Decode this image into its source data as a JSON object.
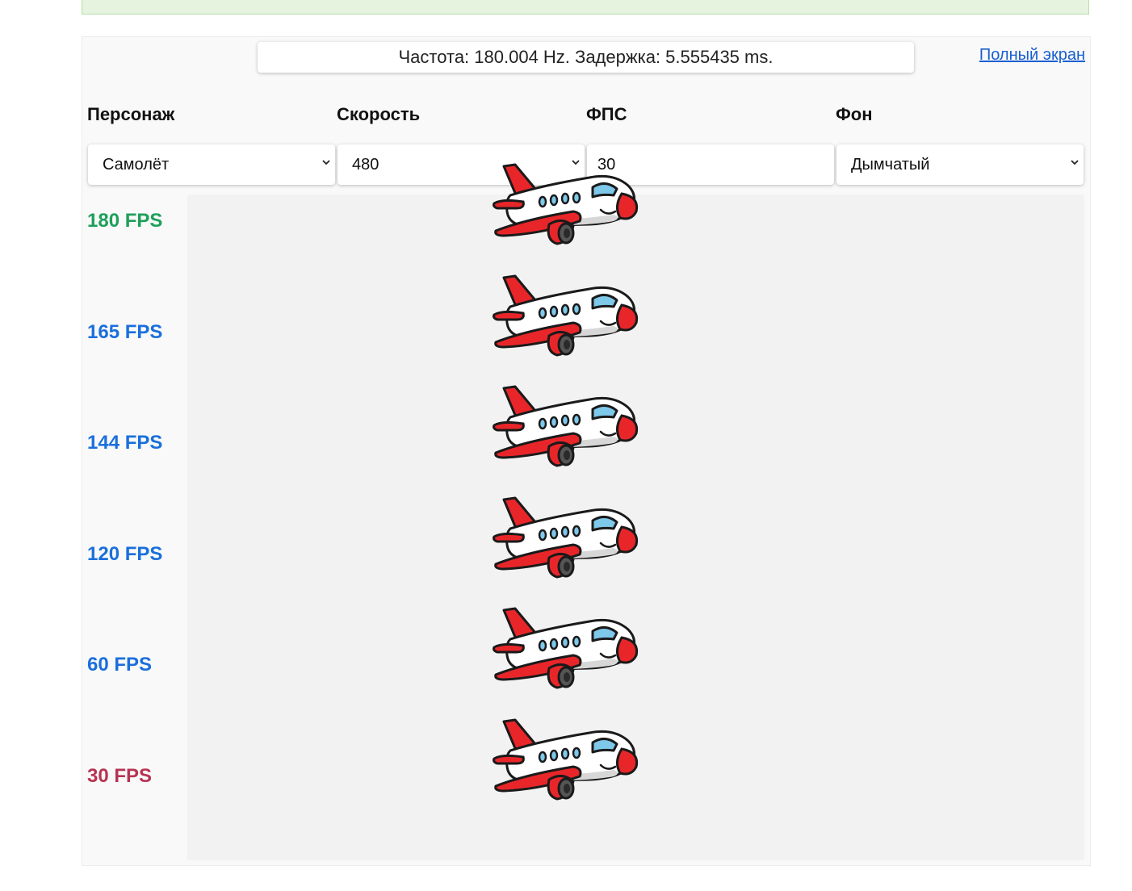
{
  "header": {
    "frequency_text": "Частота: 180.004 Hz. Задержка: 5.555435 ms.",
    "fullscreen_link": "Полный экран"
  },
  "controls": {
    "character": {
      "label": "Персонаж",
      "value": "Самолёт"
    },
    "speed": {
      "label": "Скорость",
      "value": "480"
    },
    "fps": {
      "label": "ФПС",
      "value": "30"
    },
    "background": {
      "label": "Фон",
      "value": "Дымчатый"
    }
  },
  "rows": [
    {
      "label": "180 FPS",
      "color": "#1ea05a"
    },
    {
      "label": "165 FPS",
      "color": "#1a6fdc"
    },
    {
      "label": "144 FPS",
      "color": "#1a6fdc"
    },
    {
      "label": "120 FPS",
      "color": "#1a6fdc"
    },
    {
      "label": "60 FPS",
      "color": "#1a6fdc"
    },
    {
      "label": "30 FPS",
      "color": "#b83352"
    }
  ],
  "icons": {
    "select_arrow": "chevron-down-icon",
    "sprite": "airplane-icon"
  }
}
